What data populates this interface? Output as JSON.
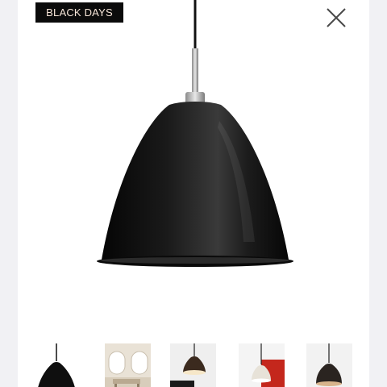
{
  "promo": {
    "badge_label": "BLACK DAYS"
  },
  "gallery": {
    "close_icon": "close-icon",
    "main_image": "black-pendant-lamp-image",
    "thumbnails": [
      {
        "name": "thumb-black-lamp",
        "icon": "black-lamp"
      },
      {
        "name": "thumb-interior-room",
        "icon": "interior-room"
      },
      {
        "name": "thumb-brown-lamp",
        "icon": "brown-lamp"
      },
      {
        "name": "thumb-red-wall-lamp",
        "icon": "red-wall-lamp"
      },
      {
        "name": "thumb-copper-lamp",
        "icon": "copper-lamp"
      }
    ]
  },
  "colors": {
    "accent_badge_bg": "#0b0b0b",
    "accent_badge_text": "#f7e6d9"
  }
}
